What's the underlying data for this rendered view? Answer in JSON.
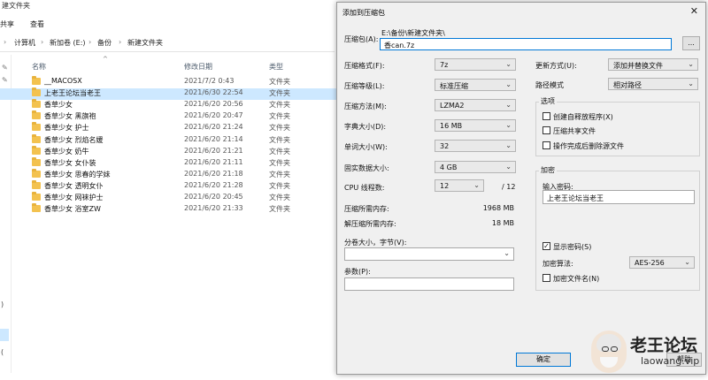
{
  "explorer": {
    "title": "建文件夹",
    "ribbon": [
      "共享",
      "查看"
    ],
    "address": [
      "计算机",
      "新加卷 (E:)",
      "备份",
      "新建文件夹"
    ],
    "columns": {
      "name": "名称",
      "date": "修改日期",
      "type": "类型"
    },
    "rows": [
      {
        "name": "__MACOSX",
        "date": "2021/7/2 0:43",
        "type": "文件夹"
      },
      {
        "name": "上老王论坛当老王",
        "date": "2021/6/30 22:54",
        "type": "文件夹"
      },
      {
        "name": "香草少女",
        "date": "2021/6/20 20:56",
        "type": "文件夹"
      },
      {
        "name": "香草少女 黑旗袍",
        "date": "2021/6/20 20:47",
        "type": "文件夹"
      },
      {
        "name": "香草少女 护士",
        "date": "2021/6/20 21:24",
        "type": "文件夹"
      },
      {
        "name": "香草少女 烈焰名媛",
        "date": "2021/6/20 21:14",
        "type": "文件夹"
      },
      {
        "name": "香草少女 奶牛",
        "date": "2021/6/20 21:21",
        "type": "文件夹"
      },
      {
        "name": "香草少女 女仆装",
        "date": "2021/6/20 21:11",
        "type": "文件夹"
      },
      {
        "name": "香草少女 思春的学妹",
        "date": "2021/6/20 21:18",
        "type": "文件夹"
      },
      {
        "name": "香草少女 透明女仆",
        "date": "2021/6/20 21:28",
        "type": "文件夹"
      },
      {
        "name": "香草少女 网袜护士",
        "date": "2021/6/20 20:45",
        "type": "文件夹"
      },
      {
        "name": "香草少女 浴室ZW",
        "date": "2021/6/20 21:33",
        "type": "文件夹"
      }
    ],
    "sidebar_fragments": [
      ")",
      "("
    ]
  },
  "dialog": {
    "title": "添加到压缩包",
    "close": "✕",
    "archive_label": "压缩包(A):",
    "archive_path": "E:\\备份\\新建文件夹\\",
    "archive_name": "香can.7z",
    "browse_label": "...",
    "format_label": "压缩格式(F):",
    "format_value": "7z",
    "level_label": "压缩等级(L):",
    "level_value": "标准压缩",
    "method_label": "压缩方法(M):",
    "method_value": "LZMA2",
    "dict_label": "字典大小(D):",
    "dict_value": "16 MB",
    "word_label": "单词大小(W):",
    "word_value": "32",
    "solid_label": "固实数据大小:",
    "solid_value": "4 GB",
    "cpu_label": "CPU 线程数:",
    "cpu_value": "12",
    "cpu_total": "/ 12",
    "mem_comp_label": "压缩所需内存:",
    "mem_comp_value": "1968 MB",
    "mem_decomp_label": "解压缩所需内存:",
    "mem_decomp_value": "18 MB",
    "split_label": "分卷大小，字节(V):",
    "params_label": "参数(P):",
    "update_label": "更新方式(U):",
    "update_value": "添加并替换文件",
    "pathmode_label": "路径模式",
    "pathmode_value": "相对路径",
    "options_title": "选项",
    "opt_sfx": "创建自释放程序(X)",
    "opt_shared": "压缩共享文件",
    "opt_delete": "操作完成后删除源文件",
    "enc_title": "加密",
    "pwd_label": "输入密码:",
    "pwd_value": "上老王论坛当老王",
    "show_pwd": "显示密码(S)",
    "show_pwd_mark": "✓",
    "enc_method_label": "加密算法:",
    "enc_method_value": "AES-256",
    "enc_names": "加密文件名(N)",
    "ok": "确定",
    "help": "帮助"
  },
  "watermark": {
    "logo": "老王论坛",
    "url": "laowang.vip"
  }
}
